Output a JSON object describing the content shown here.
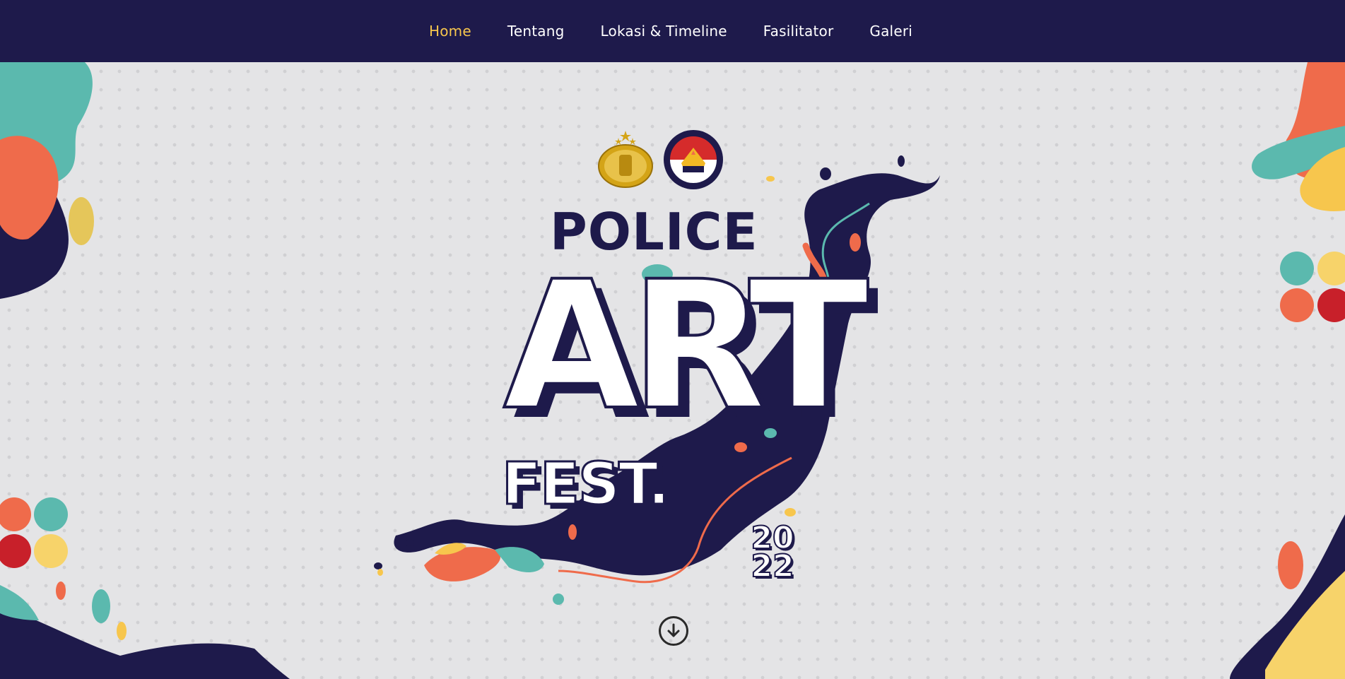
{
  "nav": {
    "items": [
      {
        "label": "Home",
        "active": true
      },
      {
        "label": "Tentang",
        "active": false
      },
      {
        "label": "Lokasi & Timeline",
        "active": false
      },
      {
        "label": "Fasilitator",
        "active": false
      },
      {
        "label": "Galeri",
        "active": false
      }
    ]
  },
  "hero": {
    "title_line1": "POLICE",
    "title_line2": "ART",
    "title_line3": "FEST.",
    "year": "2022",
    "logos": [
      "polri-emblem-icon",
      "humas-polri-logo-icon"
    ],
    "scroll_icon": "arrow-down-circle-icon"
  },
  "colors": {
    "nav_bg": "#1e1a4b",
    "nav_active": "#f7c64d",
    "page_bg": "#e4e4e6",
    "navy": "#1e1a4b",
    "teal": "#5bb9ae",
    "orange": "#ef6b4b",
    "yellow": "#f7c64d",
    "red": "#c8202a"
  }
}
